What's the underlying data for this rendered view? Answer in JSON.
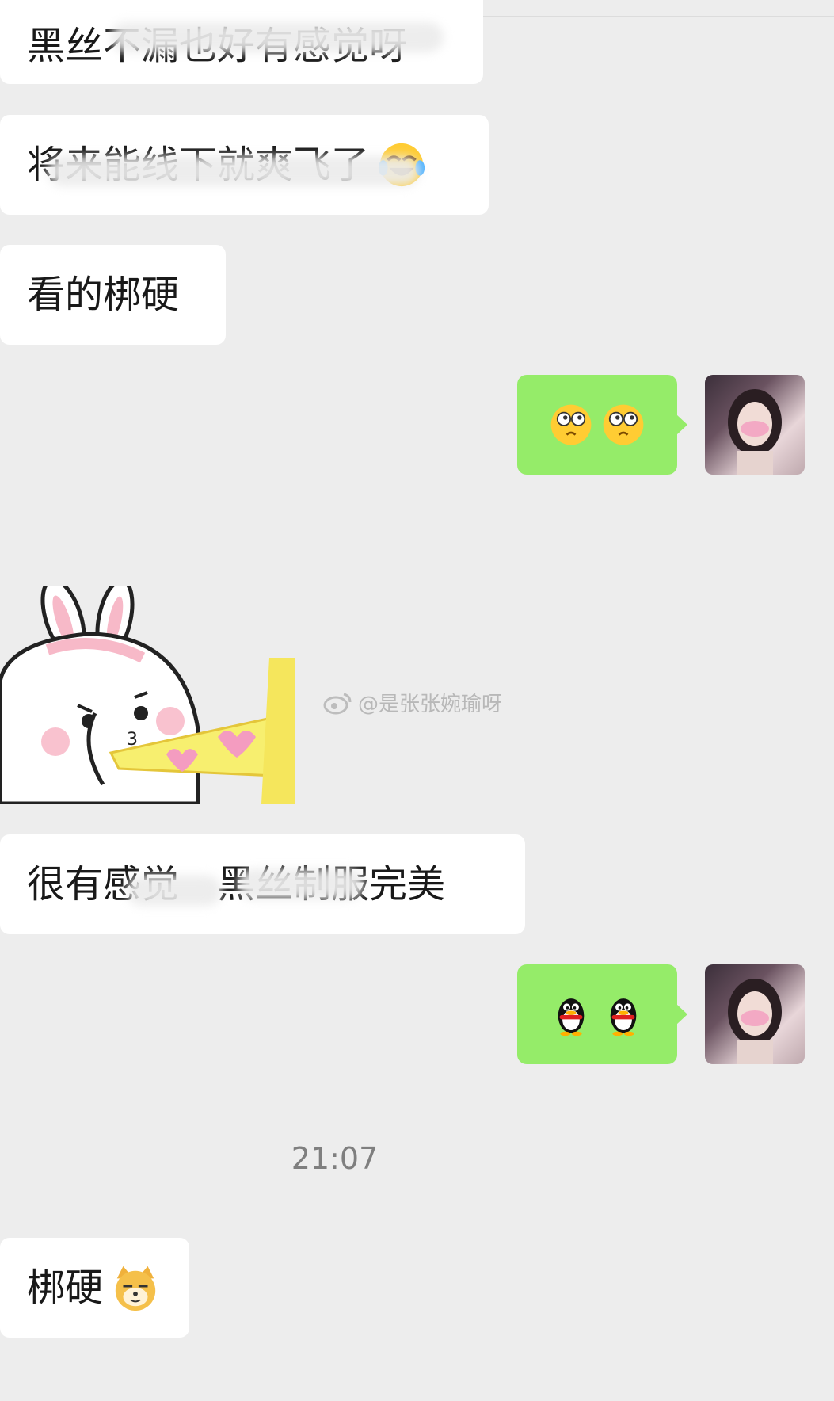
{
  "messages": {
    "m1": "黑丝不漏也好有感觉呀",
    "m2": "将来能线下就爽飞了",
    "m3": "看的梆硬",
    "m5": "很有感觉　黑丝制服完美",
    "m7": "梆硬"
  },
  "time_divider": "21:07",
  "watermark": "@是张张婉瑜呀",
  "colors": {
    "background": "#ededed",
    "incoming_bubble": "#ffffff",
    "outgoing_bubble": "#95ec69",
    "text": "#191919",
    "time": "#7f7f7f"
  },
  "icons": {
    "m2_emoji": "tears-of-joy-emoji-icon",
    "m4_emoji": "question-face-emoji-icon",
    "m6_emoji": "qq-penguin-emoji-icon",
    "m7_emoji": "doge-emoji-icon",
    "sticker": "bunny-sticker",
    "watermark_logo": "weibo-icon"
  }
}
